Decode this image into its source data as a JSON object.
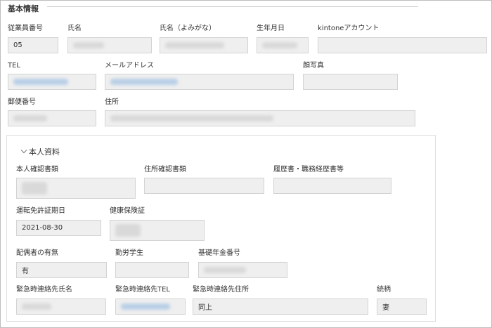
{
  "section": {
    "title": "基本情報"
  },
  "fields": {
    "employee_no": {
      "label": "従業員番号",
      "value": "05"
    },
    "name": {
      "label": "氏名"
    },
    "name_kana": {
      "label": "氏名（よみがな）"
    },
    "birthdate": {
      "label": "生年月日"
    },
    "kintone_account": {
      "label": "kintoneアカウント"
    },
    "tel": {
      "label": "TEL"
    },
    "email": {
      "label": "メールアドレス"
    },
    "photo": {
      "label": "顔写真"
    },
    "postal_code": {
      "label": "郵便番号"
    },
    "address": {
      "label": "住所"
    }
  },
  "documents": {
    "toggle_label": "本人資料",
    "identity_doc": {
      "label": "本人確認書類"
    },
    "address_doc": {
      "label": "住所確認書類"
    },
    "resume_doc": {
      "label": "履歴書・職務経歴書等"
    },
    "license_expiry": {
      "label": "運転免許証期日",
      "value": "2021-08-30"
    },
    "health_insurance": {
      "label": "健康保険証"
    },
    "spouse": {
      "label": "配偶者の有無",
      "value": "有"
    },
    "working_student": {
      "label": "勤労学生"
    },
    "pension_no": {
      "label": "基礎年金番号"
    },
    "emergency_name": {
      "label": "緊急時連絡先氏名"
    },
    "emergency_tel": {
      "label": "緊急時連絡先TEL"
    },
    "emergency_address": {
      "label": "緊急時連絡先住所",
      "value": "同上"
    },
    "relationship": {
      "label": "続柄",
      "value": "妻"
    }
  },
  "colors": {
    "field_bg": "#efefef",
    "field_border": "#d3d3d3",
    "redacted_gray": "#d9d9d9",
    "redacted_blue": "#b9cfe6"
  }
}
